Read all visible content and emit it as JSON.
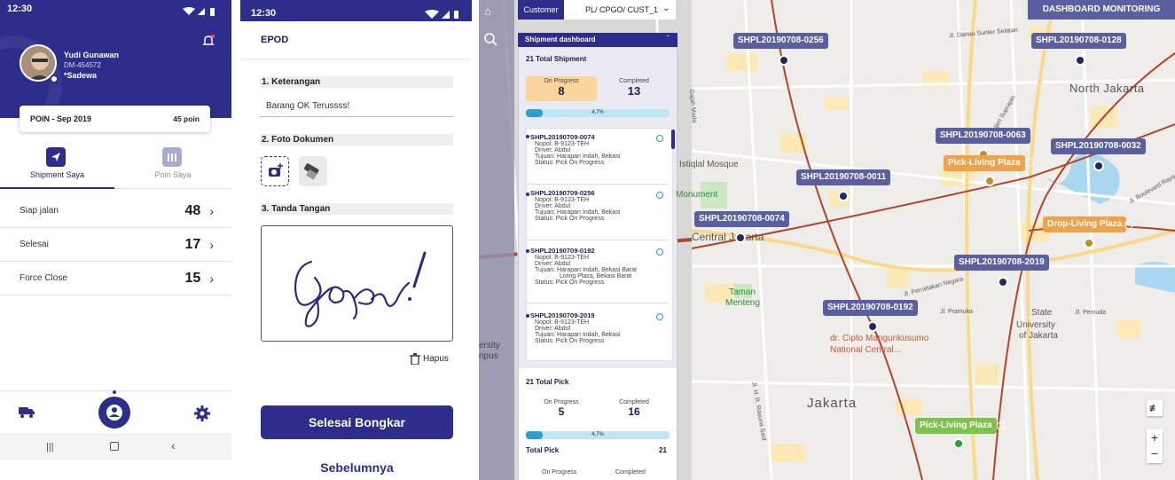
{
  "status": {
    "time_left": "12:30",
    "time_mid": "12:30"
  },
  "profile": {
    "name": "Yudi Gunawan",
    "id": "DM-454572",
    "place": "*Sadewa"
  },
  "points": {
    "label": "POIN - Sep 2019",
    "value": "45 poin"
  },
  "tabs": {
    "shipment": "Shipment Saya",
    "poin": "Poin Saya"
  },
  "stats": [
    {
      "label": "Siap jalan",
      "value": "48"
    },
    {
      "label": "Selesai",
      "value": "17"
    },
    {
      "label": "Force Close",
      "value": "15"
    }
  ],
  "epod": {
    "title": "EPOD",
    "s1": "1. Keterangan",
    "note": "Barang OK Terussss!",
    "s2": "2. Foto Dokumen",
    "s3": "3. Tanda Tangan",
    "delete": "Hapus",
    "primary": "Selesai Bongkar",
    "secondary": "Sebelumnya"
  },
  "map": {
    "customer_label": "Customer",
    "customer_value": "PL/ CPGO/ CUST_1",
    "monitor": "DASHBOARD MONITORING"
  },
  "dashboard": {
    "title": "Shipment dashboard",
    "total_shipment": "21 Total Shipment",
    "op_label": "On Progress",
    "op_value": "8",
    "c_label": "Completed",
    "c_value": "13",
    "progress": "4,7%",
    "items": [
      {
        "id": "SHPL20190709-0074",
        "nopol": "Nopol: B-9123-TEH",
        "driver": "Driver: Abdul",
        "tujuan": "Tujuan: Harapan Indah, Bekasi",
        "status": "Status: Pick On Progress"
      },
      {
        "id": "SHPL20190709-0256",
        "nopol": "Nopol: B-9123-TEH",
        "driver": "Driver: Abdul",
        "tujuan": "Tujuan: Harapan Indah, Bekasi",
        "status": "Status: Pick On Progress"
      },
      {
        "id": "SHPL20190709-0192",
        "nopol": "Nopol: B-9123-TEH",
        "driver": "Driver: Abdul",
        "tujuan": "Tujuan: Harapan Indah, Bekasi Barat",
        "tujuan2": "Living Plaza, Bekasi Barat",
        "status": "Status: Pick On Progress"
      },
      {
        "id": "SHPL20190709-2019",
        "nopol": "Nopol: B-9123-TEH",
        "driver": "Driver: Abdul",
        "tujuan": "Tujuan: Harapan Indah, Bekasi",
        "status": "Status: Pick On Progress"
      }
    ],
    "total_pick": "21 Total Pick",
    "pick_op": "5",
    "pick_c": "16",
    "pick_progress": "4,7%",
    "total_pick2": "Total Pick",
    "total_pick2_value": "21",
    "op_label2": "On Progress",
    "c_label2": "Completed"
  },
  "pins": {
    "p1": "SHPL20190708-0256",
    "p2": "SHPL20190708-0128",
    "p3": "SHPL20190708-0063",
    "p4": "SHPL20190708-0032",
    "p5": "Pick-Living Plaza",
    "p6": "SHPL20190708-0011",
    "p7": "SHPL20190708-0074",
    "p8": "Drop-Living Plaza",
    "p9": "SHPL20190708-2019",
    "p10": "SHPL20190708-0192",
    "p11": "Pick-Living Plaza"
  },
  "places": {
    "north": "North Jakarta",
    "jakarta": "Jakarta",
    "central": "Central Jakarta",
    "istiqlal": "Istiqlal Mosque",
    "monument": "Monument",
    "taman": "Taman",
    "menteng": "Menteng",
    "cipto": "dr. Cipto Mangunkusumo",
    "cipto2": "National Central...",
    "state": "State",
    "univ": "University",
    "ofjak": "of Jakarta",
    "danau": "Jl. Danau Sunter Selatan",
    "lb": "Jl. Letjen Suprapto",
    "pemuda": "Jl. Pemuda",
    "pramuka": "Jl. Pramuka",
    "percetakan": "Jl. Percetakan Negara",
    "bypass": "Jl. Boulevard Raya",
    "rasuna": "Jl. H. R. Rasuna Said",
    "ver": "ersity",
    "pus": "npus",
    "gajah": "Gajah Mada"
  }
}
